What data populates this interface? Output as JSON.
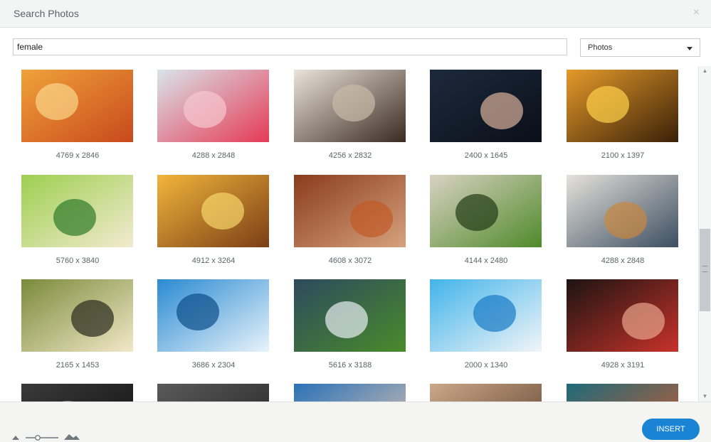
{
  "dialog": {
    "title": "Search Photos",
    "close_glyph": "×"
  },
  "search": {
    "value": "female",
    "filter_selected": "Photos"
  },
  "photos": [
    {
      "dims": "4769 x 2846",
      "icon": "woman-sunset-portrait"
    },
    {
      "dims": "4288 x 2848",
      "icon": "red-hair-woman"
    },
    {
      "dims": "4256 x 2832",
      "icon": "woman-lying-fur"
    },
    {
      "dims": "2400 x 1645",
      "icon": "ballet-dancers"
    },
    {
      "dims": "2100 x 1397",
      "icon": "woman-running-sunset"
    },
    {
      "dims": "5760 x 3840",
      "icon": "girl-in-meadow"
    },
    {
      "dims": "4912 x 3264",
      "icon": "woman-golden-field"
    },
    {
      "dims": "4608 x 3072",
      "icon": "woman-autumn-leaves"
    },
    {
      "dims": "4144 x 2480",
      "icon": "green-eye"
    },
    {
      "dims": "4288 x 2848",
      "icon": "laptop-desk"
    },
    {
      "dims": "2165 x 1453",
      "icon": "legs-sneakers-car"
    },
    {
      "dims": "3686 x 2304",
      "icon": "blue-water-figure"
    },
    {
      "dims": "5616 x 3188",
      "icon": "angel-woman-field"
    },
    {
      "dims": "2000 x 1340",
      "icon": "woman-blue-hat-beach"
    },
    {
      "dims": "4928 x 3191",
      "icon": "woman-face-hand"
    },
    {
      "dims": "",
      "icon": "partial-bw"
    },
    {
      "dims": "",
      "icon": "partial-bw-2"
    },
    {
      "dims": "",
      "icon": "partial-bokeh"
    },
    {
      "dims": "",
      "icon": "partial-shelf"
    },
    {
      "dims": "",
      "icon": "partial-street"
    }
  ],
  "footer": {
    "insert_label": "INSERT"
  },
  "colors": {
    "accent": "#1a84d4"
  }
}
